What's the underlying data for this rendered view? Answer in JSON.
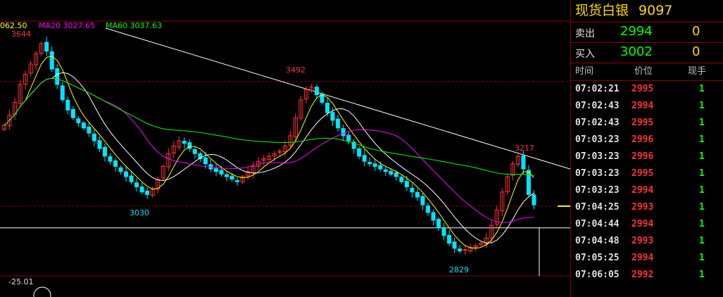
{
  "chart_data": {
    "type": "candlestick",
    "ylim": [
      2760,
      3700
    ],
    "ma_legend": [
      {
        "label": "062.50",
        "color": "#ffff00"
      },
      {
        "label": "MA20 3027.65",
        "color": "#ff00ff"
      },
      {
        "label": "MA60 3037.63",
        "color": "#00ff00"
      }
    ],
    "annotations": {
      "high1": "3644",
      "peak2": "3492",
      "low1": "3030",
      "peak3": "3217",
      "low2": "2829",
      "osc": "-25.01"
    },
    "closes": [
      3320,
      3360,
      3410,
      3480,
      3520,
      3560,
      3600,
      3640,
      3610,
      3540,
      3480,
      3420,
      3380,
      3350,
      3330,
      3310,
      3290,
      3260,
      3230,
      3200,
      3180,
      3160,
      3140,
      3120,
      3100,
      3080,
      3060,
      3050,
      3070,
      3110,
      3160,
      3210,
      3240,
      3260,
      3250,
      3230,
      3210,
      3190,
      3170,
      3150,
      3140,
      3130,
      3120,
      3110,
      3100,
      3120,
      3140,
      3160,
      3180,
      3190,
      3200,
      3210,
      3220,
      3240,
      3280,
      3350,
      3420,
      3460,
      3470,
      3440,
      3410,
      3370,
      3340,
      3310,
      3280,
      3260,
      3230,
      3200,
      3180,
      3170,
      3160,
      3150,
      3140,
      3130,
      3120,
      3100,
      3080,
      3060,
      3040,
      3010,
      2980,
      2950,
      2920,
      2890,
      2860,
      2840,
      2830,
      2835,
      2845,
      2850,
      2860,
      2880,
      2930,
      2990,
      3060,
      3120,
      3170,
      3200,
      3150,
      3050,
      3010
    ]
  },
  "panel": {
    "title": "现货白银",
    "code": "9097",
    "sell_label": "卖出",
    "sell_price": "2994",
    "sell_vol": "0",
    "buy_label": "买入",
    "buy_price": "3002",
    "buy_vol": "0",
    "col_time": "时间",
    "col_price": "价位",
    "col_vol": "现手",
    "rows": [
      {
        "time": "07:02:21",
        "price": "2995",
        "vol": "1",
        "color": "#ff3333"
      },
      {
        "time": "07:02:43",
        "price": "2994",
        "vol": "1",
        "color": "#ff3333"
      },
      {
        "time": "07:02:43",
        "price": "2995",
        "vol": "1",
        "color": "#ff3333"
      },
      {
        "time": "07:03:23",
        "price": "2996",
        "vol": "1",
        "color": "#ff3333"
      },
      {
        "time": "07:03:23",
        "price": "2996",
        "vol": "1",
        "color": "#ff3333"
      },
      {
        "time": "07:03:23",
        "price": "2995",
        "vol": "1",
        "color": "#ff3333"
      },
      {
        "time": "07:03:23",
        "price": "2994",
        "vol": "1",
        "color": "#ff3333"
      },
      {
        "time": "07:04:25",
        "price": "2993",
        "vol": "1",
        "color": "#ff3333"
      },
      {
        "time": "07:04:44",
        "price": "2994",
        "vol": "1",
        "color": "#ff3333"
      },
      {
        "time": "07:04:48",
        "price": "2993",
        "vol": "1",
        "color": "#ff3333"
      },
      {
        "time": "07:05:25",
        "price": "2994",
        "vol": "1",
        "color": "#ff3333"
      },
      {
        "time": "07:06:05",
        "price": "2992",
        "vol": "1",
        "color": "#ff3333"
      }
    ]
  },
  "colors": {
    "up": "#ff3333",
    "down": "#00e5ff",
    "grid": "#8b0000",
    "trend": "#ffffff",
    "ma5": "#ffff00",
    "ma10": "#ffffff",
    "ma20": "#ff00ff",
    "ma60": "#00ff00"
  }
}
